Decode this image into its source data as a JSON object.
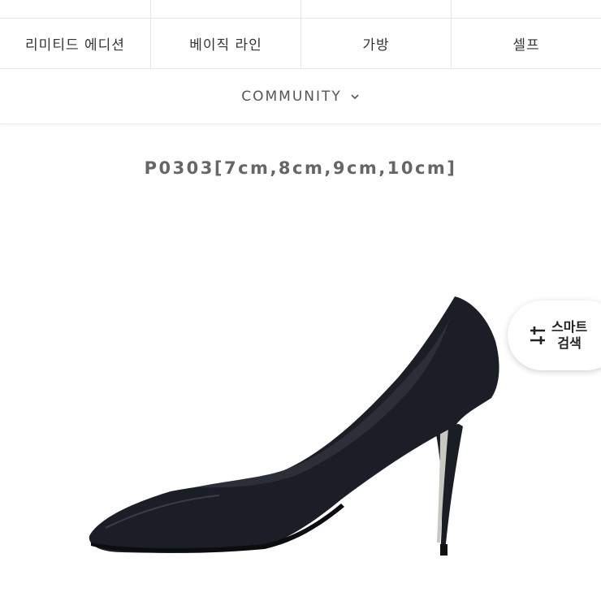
{
  "category_nav": {
    "items": [
      {
        "label": "리미티드 에디션"
      },
      {
        "label": "베이직 라인"
      },
      {
        "label": "가방"
      },
      {
        "label": "셀프"
      }
    ]
  },
  "community_menu": {
    "label": "COMMUNITY",
    "icon": "chevron-down-icon"
  },
  "product": {
    "title": "P0303[7cm,8cm,9cm,10cm]",
    "image_description_icon": "black-pump-shoe"
  },
  "smart_search": {
    "line1": "스마트",
    "line2": "검색",
    "icon": "sliders-icon"
  },
  "colors": {
    "border": "#e6e6e6",
    "text": "#333333",
    "shoe": "#1a1d24"
  }
}
